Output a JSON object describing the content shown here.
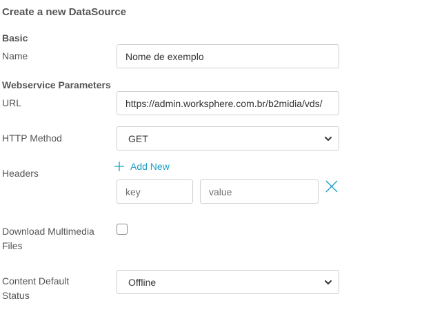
{
  "page_title": "Create a new DataSource",
  "sections": {
    "basic": "Basic",
    "webservice": "Webservice Parameters"
  },
  "fields": {
    "name": {
      "label": "Name",
      "value": "Nome de exemplo"
    },
    "url": {
      "label": "URL",
      "value": "https://admin.worksphere.com.br/b2midia/vds/"
    },
    "http_method": {
      "label": "HTTP Method",
      "selected": "GET"
    },
    "headers": {
      "label": "Headers",
      "add_new_label": "Add New",
      "key_placeholder": "key",
      "value_placeholder": "value"
    },
    "download_multimedia": {
      "label_line1": "Download Multimedia",
      "label_line2": "Files",
      "checked": false
    },
    "content_default_status": {
      "label_line1": "Content Default",
      "label_line2": "Status",
      "selected": "Offline"
    }
  },
  "colors": {
    "accent": "#1aa0c4",
    "text": "#555555",
    "border": "#cfcfcf"
  },
  "icons": {
    "add": "plus-icon",
    "remove": "close-icon",
    "dropdown": "chevron-down-icon"
  }
}
